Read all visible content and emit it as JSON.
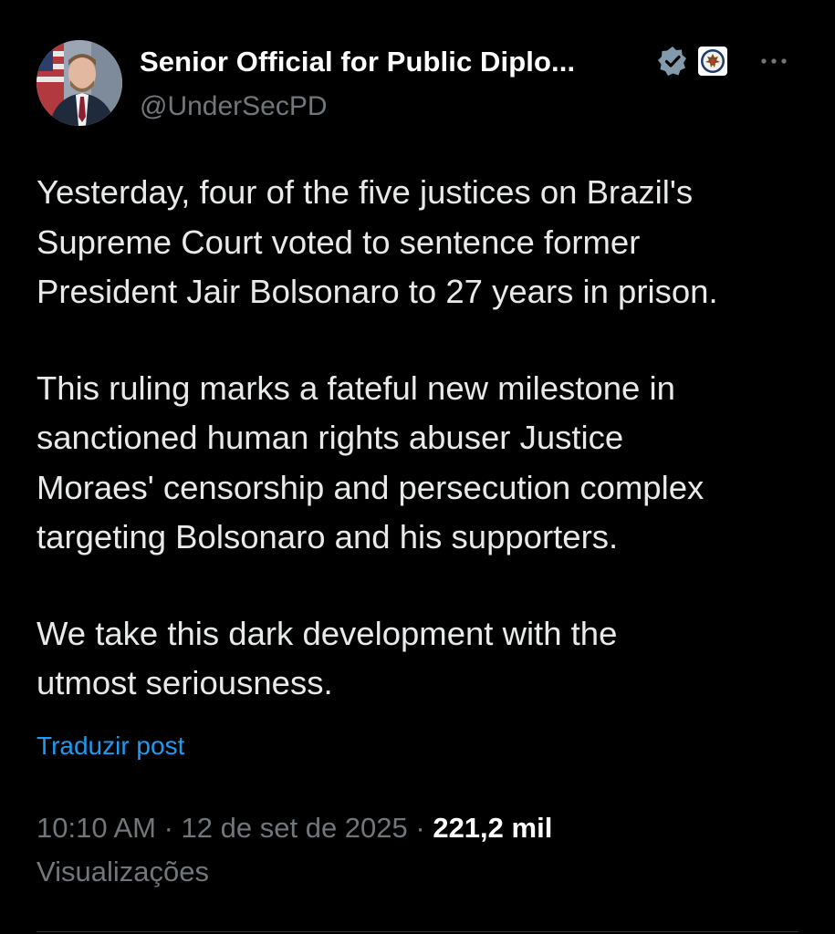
{
  "author": {
    "name": "Senior Official for Public Diplo...",
    "handle": "@UnderSecPD",
    "verified_icon": "verified-badge-icon",
    "affiliation_icon": "us-state-department-seal-icon"
  },
  "post": {
    "paragraphs": [
      "Yesterday, four of the five justices on Brazil's\nSupreme Court voted to sentence former\nPresident Jair Bolsonaro to 27 years in prison.",
      "This ruling marks a fateful new milestone in\nsanctioned human rights abuser Justice\nMoraes' censorship and persecution complex\ntargeting Bolsonaro and his supporters.",
      "We take this dark development with the\nutmost seriousness."
    ],
    "translate_label": "Traduzir post"
  },
  "meta": {
    "time": "10:10 AM",
    "separator": " · ",
    "date": "12 de set de 2025",
    "views_count": "221,2 mil",
    "views_label": "Visualizações"
  },
  "colors": {
    "background": "#000000",
    "text": "#e7e9ea",
    "secondary": "#71767b",
    "link": "#1d9bf0",
    "verified_badge": "#829aab"
  }
}
